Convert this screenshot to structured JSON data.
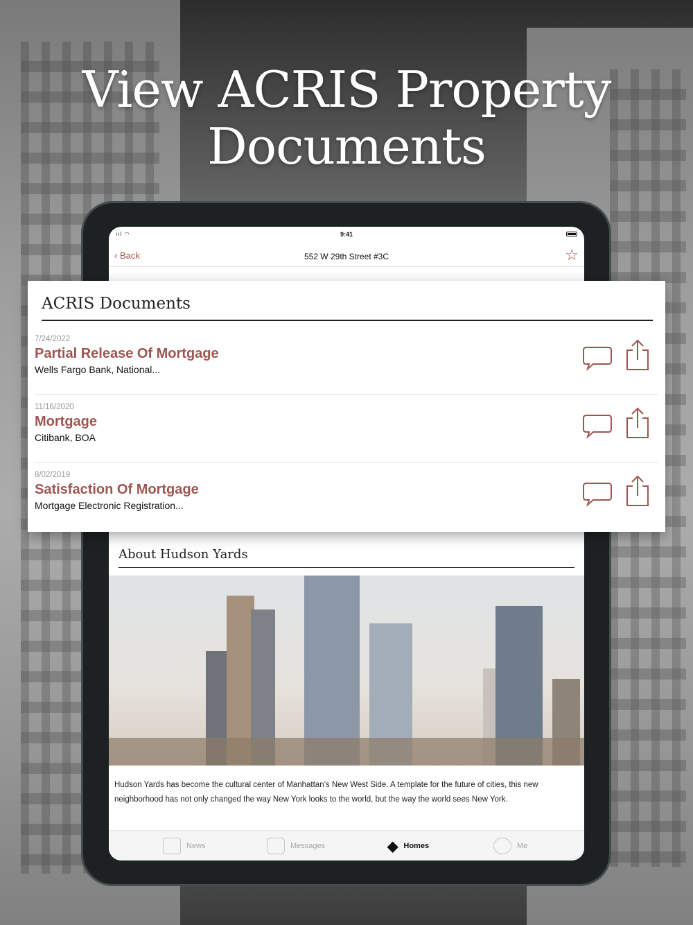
{
  "headline": {
    "line1": "View ACRIS Property",
    "line2": "Documents"
  },
  "status_bar": {
    "time": "9:41"
  },
  "nav": {
    "back_label": "Back",
    "title": "552 W 29th Street #3C",
    "favorite_icon": "star-icon"
  },
  "acris": {
    "title": "ACRIS Documents",
    "documents": [
      {
        "date": "7/24/2022",
        "title": "Partial Release Of Mortgage",
        "party": "Wells Fargo Bank, National..."
      },
      {
        "date": "11/16/2020",
        "title": "Mortgage",
        "party": "Citibank, BOA"
      },
      {
        "date": "8/02/2019",
        "title": "Satisfaction Of Mortgage",
        "party": "Mortgage Electronic Registration..."
      }
    ]
  },
  "about": {
    "title": "About Hudson Yards",
    "description": "Hudson Yards has become the cultural center of Manhattan’s New West Side. A template for the future of cities, this new neighborhood has not only changed the way New York looks to the world, but the way the world sees New York."
  },
  "tabs": [
    {
      "label": "News",
      "icon": "newspaper-icon",
      "active": false
    },
    {
      "label": "Messages",
      "icon": "chat-bubble-icon",
      "active": false
    },
    {
      "label": "Homes",
      "icon": "map-pin-icon",
      "active": true
    },
    {
      "label": "Me",
      "icon": "user-icon",
      "active": false
    }
  ],
  "colors": {
    "accent": "#9e5550",
    "text": "#111111",
    "muted": "#999999"
  }
}
